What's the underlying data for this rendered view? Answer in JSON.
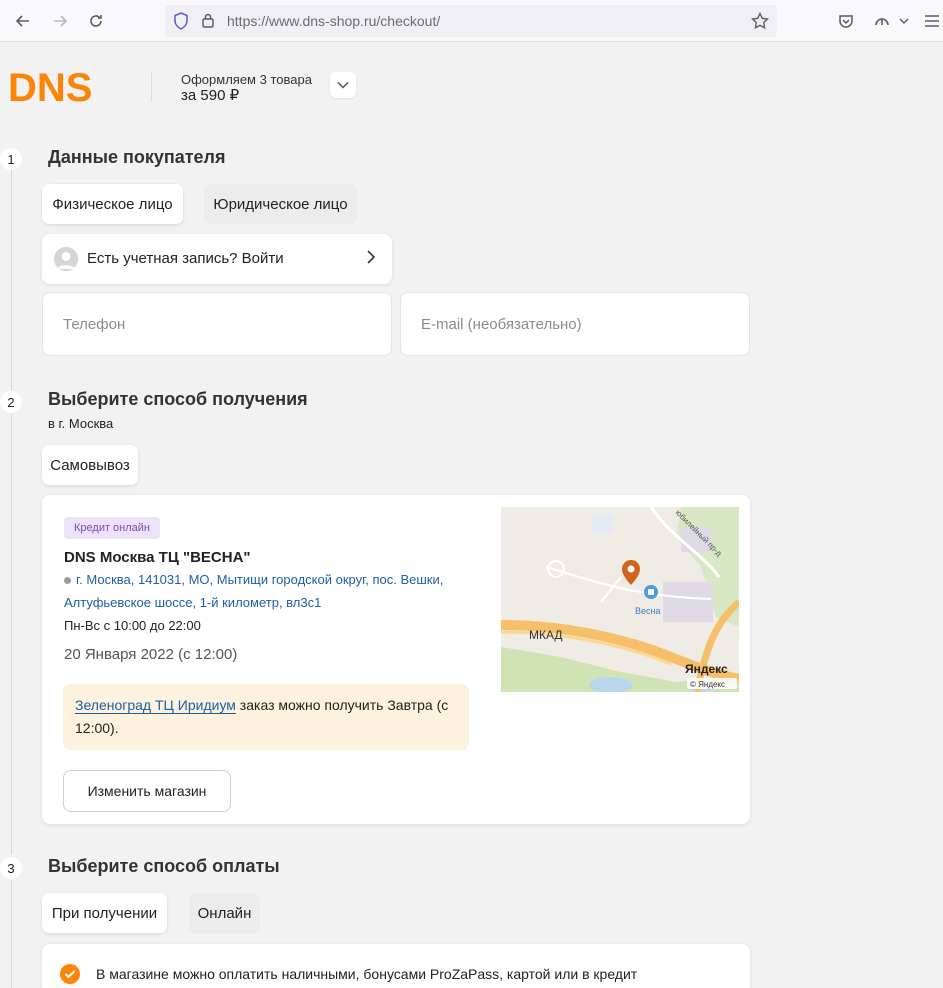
{
  "browser": {
    "url_host": "https://www.dns-shop.ru",
    "url_path": "/checkout/"
  },
  "header": {
    "logo_text": "DNS",
    "order_line1": "Оформляем 3 товара",
    "order_line2": "за 590 ₽"
  },
  "step1": {
    "number": "1",
    "title": "Данные покупателя",
    "tab_individual": "Физическое лицо",
    "tab_legal": "Юридическое лицо",
    "login_text": "Есть учетная запись? Войти",
    "phone_placeholder": "Телефон",
    "email_placeholder": "E-mail (необязательно)"
  },
  "step2": {
    "number": "2",
    "title": "Выберите способ получения",
    "city": "в г. Москва",
    "method_pickup": "Самовывоз",
    "store": {
      "badge": "Кредит онлайн",
      "name": "DNS Москва ТЦ \"ВЕСНА\"",
      "address": "г. Москва, 141031, МО, Мытищи городской округ, пос. Вешки, Алтуфьевское шоссе, 1-й километр, вл3с1",
      "hours": "Пн-Вс с 10:00 до 22:00",
      "date": "20 Января 2022 (с 12:00)",
      "note_link": "Зеленоград ТЦ Иридиум",
      "note_text": " заказ можно получить Завтра (с 12:00).",
      "change_button": "Изменить магазин",
      "map": {
        "label_store": "Весна",
        "label_road": "МКАД",
        "label_street": "юбилейный пр-д",
        "label_brand": "Яндекс",
        "label_copyright": "© Яндекс"
      }
    }
  },
  "step3": {
    "number": "3",
    "title": "Выберите способ оплаты",
    "method_on_receipt": "При получении",
    "method_online": "Онлайн",
    "payment_info": "В магазине можно оплатить наличными, бонусами ProZaPass, картой или в кредит"
  },
  "colors": {
    "brand_orange": "#fc8507",
    "link_blue": "#1d5fa6",
    "badge_purple": "#7a4ab8",
    "note_bg": "#fdf2de"
  }
}
